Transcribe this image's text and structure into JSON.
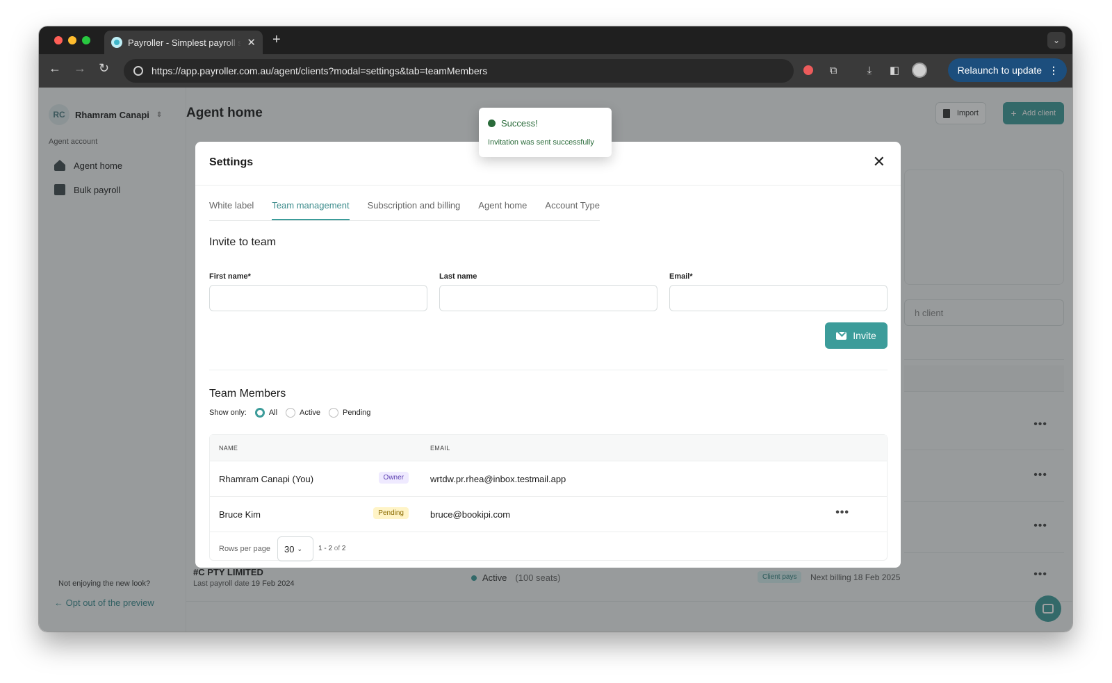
{
  "browser": {
    "tab_title": "Payroller - Simplest payroll software",
    "url": "https://app.payroller.com.au/agent/clients?modal=settings&tab=teamMembers",
    "relaunch_label": "Relaunch to update"
  },
  "sidebar": {
    "user_initials": "RC",
    "user_name": "Rhamram Canapi",
    "section_label": "Agent account",
    "items": [
      {
        "label": "Agent home",
        "icon": "home-icon"
      },
      {
        "label": "Bulk payroll",
        "icon": "payroll-icon"
      }
    ],
    "not_enjoying": "Not enjoying the new look?",
    "opt_out": "Opt out of the preview"
  },
  "main": {
    "title": "Agent home",
    "import_label": "Import",
    "add_client_label": "Add client",
    "search_placeholder_fragment": "h client",
    "client": {
      "name": "#C PTY LIMITED",
      "last_payroll_label": "Last payroll date",
      "last_payroll_date": "19 Feb 2024",
      "status": "Active",
      "seats": "(100 seats)",
      "billing_badge": "Client pays",
      "next_billing": "Next billing 18 Feb 2025"
    }
  },
  "toast": {
    "title": "Success!",
    "message": "Invitation was sent successfully"
  },
  "modal": {
    "title": "Settings",
    "tabs": [
      {
        "label": "White label",
        "active": false
      },
      {
        "label": "Team management",
        "active": true
      },
      {
        "label": "Subscription and billing",
        "active": false
      },
      {
        "label": "Agent home",
        "active": false
      },
      {
        "label": "Account Type",
        "active": false
      }
    ],
    "invite": {
      "heading": "Invite to team",
      "first_name_label": "First name*",
      "last_name_label": "Last name",
      "email_label": "Email*",
      "first_name_value": "",
      "last_name_value": "",
      "email_value": "",
      "button_label": "Invite"
    },
    "team": {
      "heading": "Team Members",
      "show_only_label": "Show only:",
      "filters": [
        {
          "label": "All",
          "checked": true
        },
        {
          "label": "Active",
          "checked": false
        },
        {
          "label": "Pending",
          "checked": false
        }
      ],
      "columns": {
        "name": "NAME",
        "email": "EMAIL"
      },
      "rows": [
        {
          "name": "Rhamram Canapi (You)",
          "badge": "Owner",
          "email": "wrtdw.pr.rhea@inbox.testmail.app"
        },
        {
          "name": "Bruce Kim",
          "badge": "Pending",
          "email": "bruce@bookipi.com"
        }
      ],
      "rows_per_page_label": "Rows per page",
      "rows_per_page": "30",
      "range": "1 - 2",
      "range_of": "of",
      "range_total": "2"
    }
  },
  "colors": {
    "accent": "#3c9c9a",
    "success": "#2a6b3a",
    "owner_badge": "#efeaff",
    "pending_badge": "#fff4c7"
  }
}
